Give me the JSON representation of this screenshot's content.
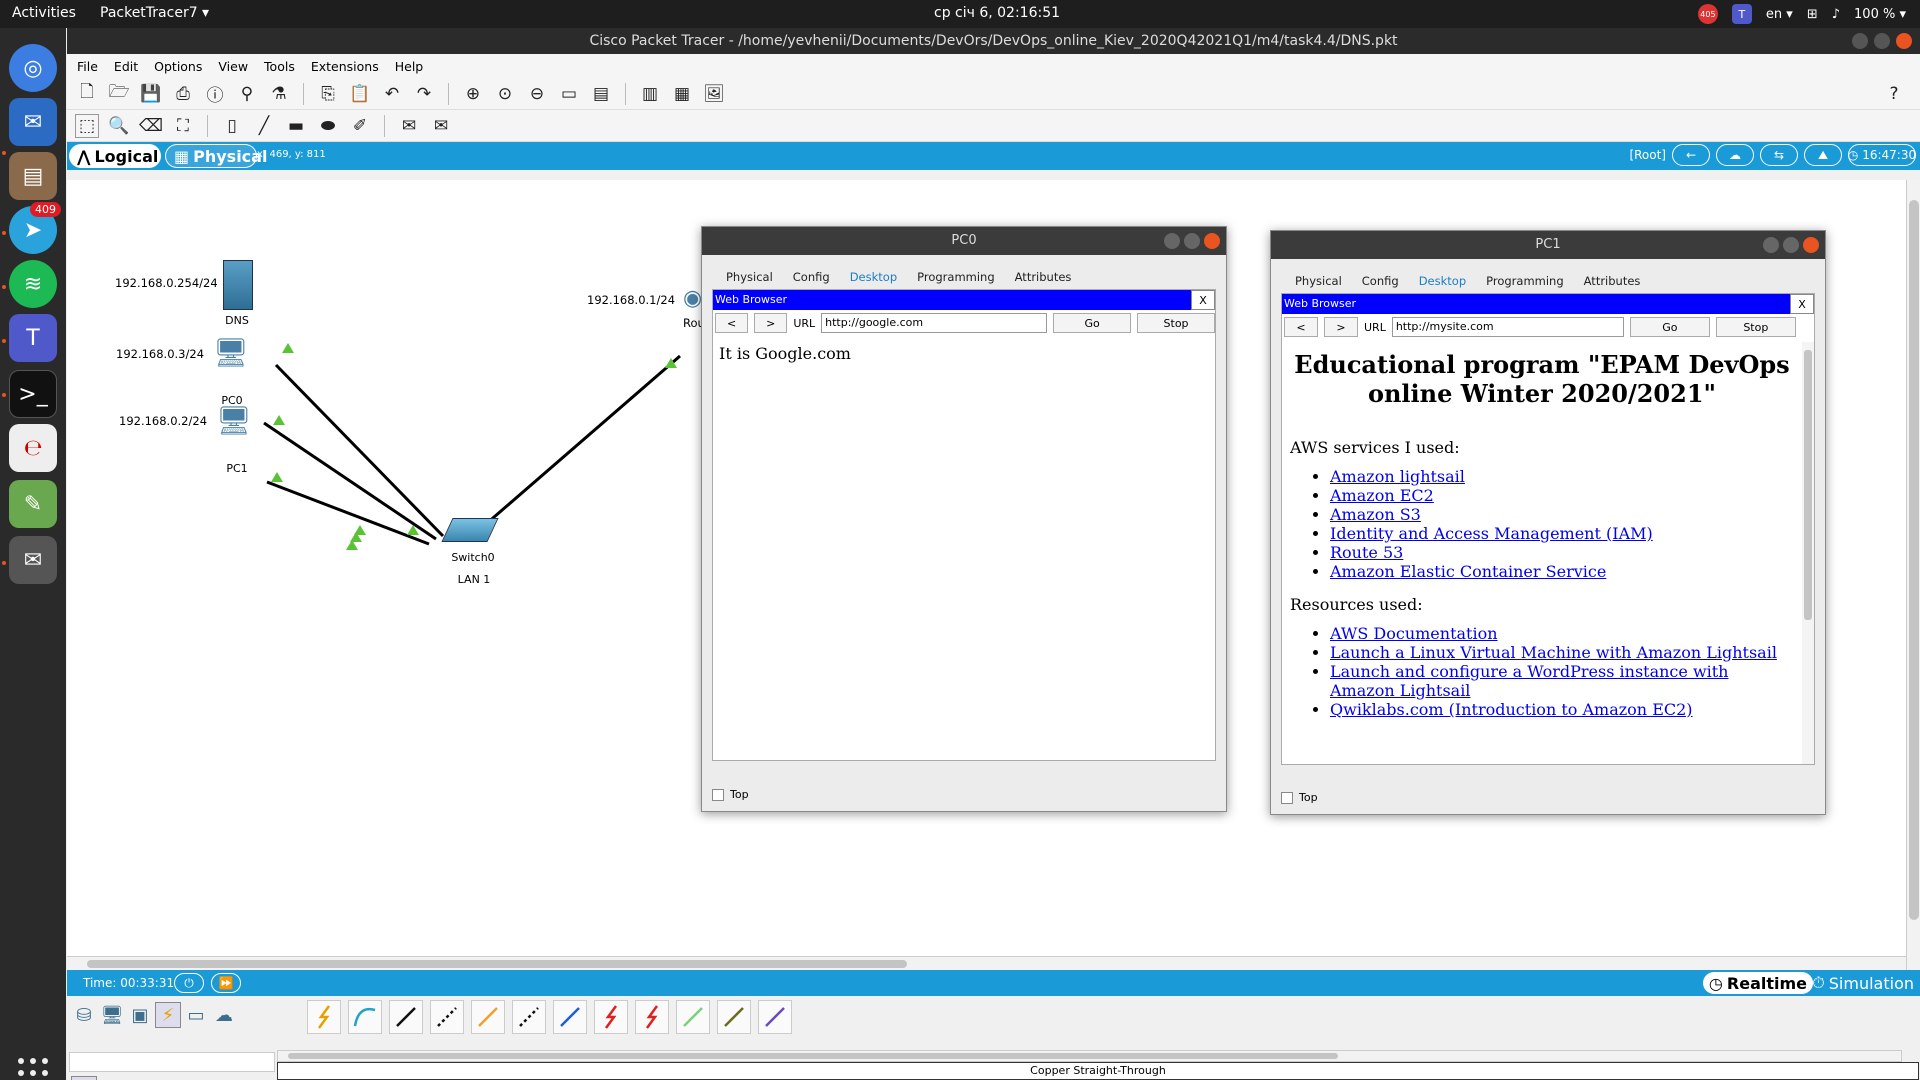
{
  "topbar": {
    "activities": "Activities",
    "app": "PacketTracer7 ▾",
    "clock": "ср січ  6, 02:16:51",
    "tray_badge": "405",
    "lang": "en ▾",
    "battery": "100 % ▾"
  },
  "dock": {
    "telegram_badge": "409"
  },
  "window": {
    "title": "Cisco Packet Tracer - /home/yevhenii/Documents/DevOrs/DevOps_online_Kiev_2020Q42021Q1/m4/task4.4/DNS.pkt"
  },
  "menu": [
    "File",
    "Edit",
    "Options",
    "View",
    "Tools",
    "Extensions",
    "Help"
  ],
  "modebar": {
    "logical": "Logical",
    "physical": "Physical",
    "coords": "x: 469, y: 811",
    "root": "[Root]",
    "clock": "16:47:30"
  },
  "network": {
    "dns_ip": "192.168.0.254/24",
    "dns_name": "DNS",
    "pc0_ip": "192.168.0.3/24",
    "pc0_name": "PC0",
    "pc1_ip": "192.168.0.2/24",
    "pc1_name": "PC1",
    "switch_name": "Switch0",
    "switch_lan": "LAN 1",
    "router_ip": "192.168.0.1/24",
    "router_name": "Rou"
  },
  "tabs": [
    "Physical",
    "Config",
    "Desktop",
    "Programming",
    "Attributes"
  ],
  "pc0": {
    "title": "PC0",
    "browser_title": "Web Browser",
    "close": "X",
    "back": "<",
    "forward": ">",
    "url_label": "URL",
    "url": "http://google.com",
    "go": "Go",
    "stop": "Stop",
    "content": "It is Google.com",
    "top_label": "Top"
  },
  "pc1": {
    "title": "PC1",
    "browser_title": "Web Browser",
    "close": "X",
    "back": "<",
    "forward": ">",
    "url_label": "URL",
    "url": "http://mysite.com",
    "go": "Go",
    "stop": "Stop",
    "heading": "Educational program \"EPAM DevOps online Winter 2020/2021\"",
    "aws_heading": "AWS services I used:",
    "aws_links": [
      "Amazon lightsail",
      "Amazon EC2",
      "Amazon S3",
      "Identity and Access Management (IAM)",
      "Route 53",
      "Amazon Elastic Container Service"
    ],
    "res_heading": "Resources used:",
    "res_links": [
      "AWS Documentation",
      "Launch a Linux Virtual Machine with Amazon Lightsail",
      "Launch and configure a WordPress instance with Amazon Lightsail",
      "Qwiklabs.com (Introduction to Amazon EC2)"
    ],
    "top_label": "Top"
  },
  "bottom": {
    "time": "Time: 00:33:31",
    "realtime": "Realtime",
    "simulation": "Simulation",
    "cable_label": "Copper Straight-Through"
  },
  "cable_colors": [
    "#e8a000",
    "#1fa4c9",
    "#111111",
    "#111111",
    "#f0a030",
    "#111111",
    "#1d5fd6",
    "#e02020",
    "#e02020",
    "#7ad07a",
    "#6b6b1f",
    "#6a4bc4"
  ]
}
